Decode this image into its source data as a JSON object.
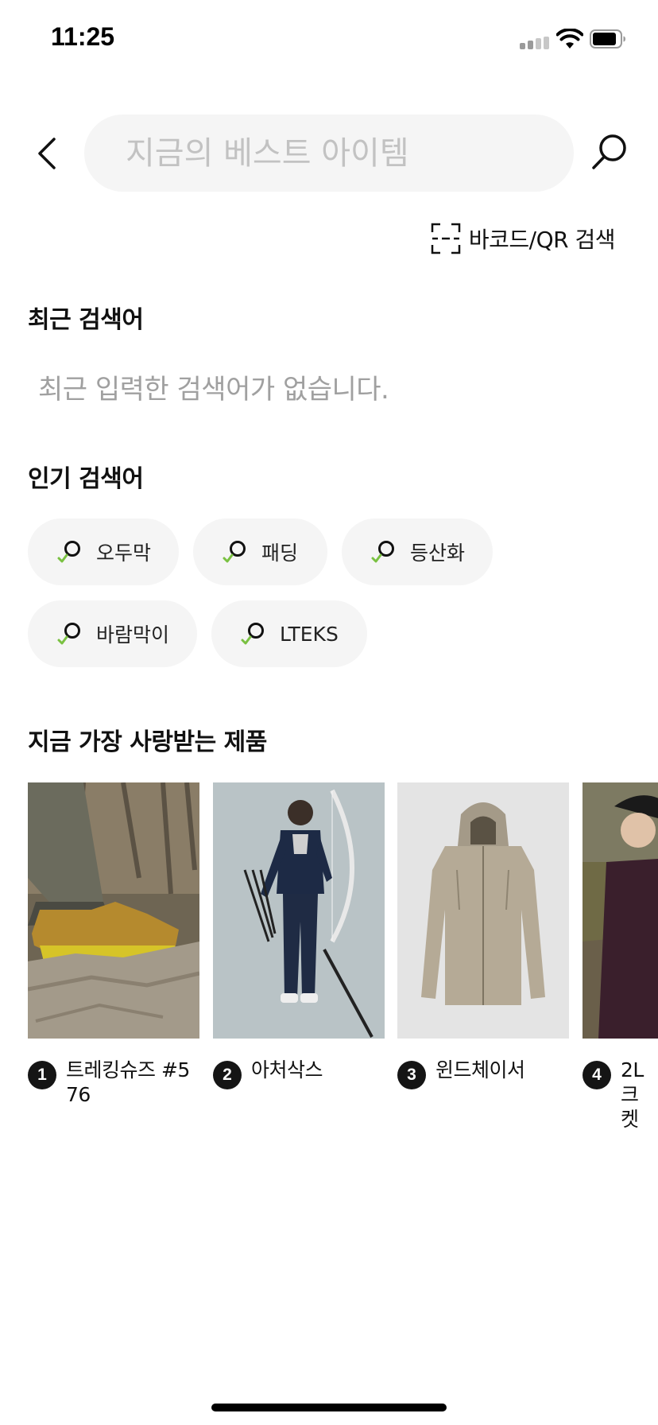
{
  "status_bar": {
    "time": "11:25"
  },
  "search": {
    "placeholder": "지금의 베스트 아이템",
    "value": ""
  },
  "barcode": {
    "label": "바코드/QR 검색"
  },
  "recent": {
    "title": "최근 검색어",
    "empty_message": "최근 입력한 검색어가 없습니다."
  },
  "popular": {
    "title": "인기 검색어",
    "chips": [
      {
        "label": "오두막"
      },
      {
        "label": "패딩"
      },
      {
        "label": "등산화"
      },
      {
        "label": "바람막이"
      },
      {
        "label": "LTEKS"
      }
    ]
  },
  "loved": {
    "title": "지금 가장 사랑받는 제품",
    "products": [
      {
        "rank": "1",
        "name": "트레킹슈즈 #576",
        "icon": "hiking-boot-photo"
      },
      {
        "rank": "2",
        "name": "아처삭스",
        "icon": "archer-photo"
      },
      {
        "rank": "3",
        "name": "윈드체이서",
        "icon": "hooded-jacket-photo"
      },
      {
        "rank": "4",
        "name": "2L 크 켓",
        "icon": "woman-in-cap-photo"
      }
    ]
  },
  "colors": {
    "chip_background": "#f5f5f5",
    "chip_accent": "#7ac142",
    "placeholder": "#c2c2c2",
    "muted_text": "#a0a0a0",
    "badge": "#151515"
  }
}
